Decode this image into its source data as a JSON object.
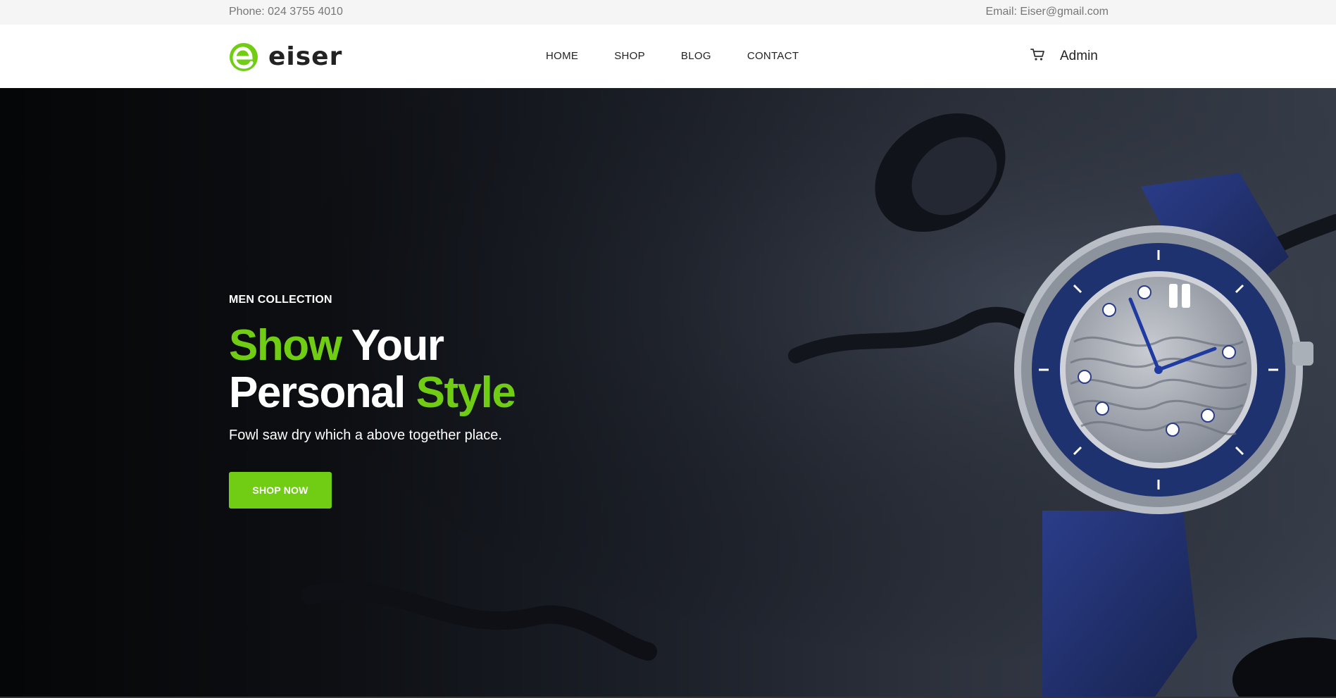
{
  "topbar": {
    "phone": "Phone: 024 3755 4010",
    "email": "Email: Eiser@gmail.com"
  },
  "header": {
    "logo_text": "eiser",
    "nav": [
      {
        "label": "HOME"
      },
      {
        "label": "SHOP"
      },
      {
        "label": "BLOG"
      },
      {
        "label": "CONTACT"
      }
    ],
    "cart_icon": "cart-icon",
    "user_label": "Admin"
  },
  "hero": {
    "subtitle": "MEN COLLECTION",
    "title_part1": "Show",
    "title_part2": " Your",
    "title_part3": "Personal ",
    "title_part4": "Style",
    "description": "Fowl saw dry which a above together place.",
    "button_label": "SHOP NOW",
    "image_subject": "luxury wristwatch with blue bezel on dark background"
  },
  "colors": {
    "accent": "#71cd14",
    "topbar_bg": "#f5f5f5",
    "text_dark": "#222222",
    "hero_bg": "#1c2029"
  }
}
